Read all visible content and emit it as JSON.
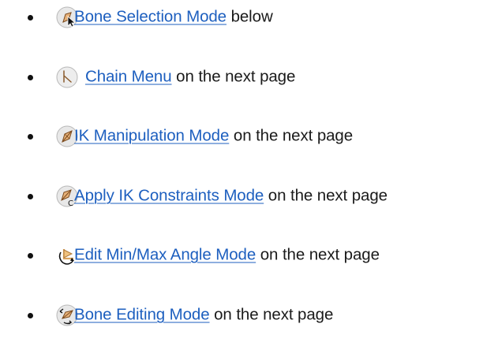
{
  "items": [
    {
      "icon": "bone-selection-mode-icon",
      "link": "Bone Selection Mode",
      "suffix": " below"
    },
    {
      "icon": "chain-menu-icon",
      "link": "Chain Menu",
      "suffix": " on the next page"
    },
    {
      "icon": "ik-manipulation-mode-icon",
      "link": "IK Manipulation Mode",
      "suffix": " on the next page"
    },
    {
      "icon": "apply-ik-constraints-mode-icon",
      "link": "Apply IK Constraints Mode",
      "suffix": " on the next page"
    },
    {
      "icon": "edit-min-max-angle-mode-icon",
      "link": "Edit Min/Max Angle Mode",
      "suffix": " on the next page"
    },
    {
      "icon": "bone-editing-mode-icon",
      "link": "Bone Editing Mode",
      "suffix": " on the next page"
    }
  ],
  "colors": {
    "link": "#1d5fbf",
    "text": "#1a1a1a",
    "bullet": "#111111"
  }
}
